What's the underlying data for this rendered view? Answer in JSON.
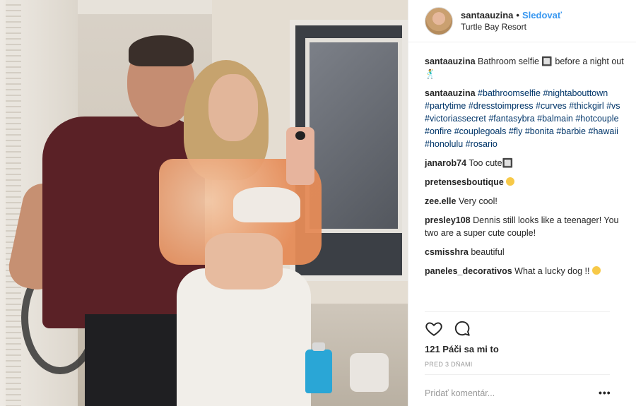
{
  "header": {
    "username": "santaauzina",
    "separator": "•",
    "follow_label": "Sledovať",
    "location": "Turtle Bay Resort"
  },
  "caption": {
    "username": "santaauzina",
    "text": "Bathroom selfie 🔲 before a night out 🕺"
  },
  "hashtags_comment": {
    "username": "santaauzina",
    "tags": [
      "#bathroomselfie",
      "#nightabouttown",
      "#partytime",
      "#dresstoimpress",
      "#curves",
      "#thickgirl",
      "#vs",
      "#victoriassecret",
      "#fantasybra",
      "#balmain",
      "#hotcouple",
      "#onfire",
      "#couplegoals",
      "#fly",
      "#bonita",
      "#barbie",
      "#hawaii",
      "#honolulu",
      "#rosario"
    ]
  },
  "comments": [
    {
      "username": "janarob74",
      "text": "Too cute🔲"
    },
    {
      "username": "pretensesboutique",
      "text": ""
    },
    {
      "username": "zee.elle",
      "text": "Very cool!"
    },
    {
      "username": "presley108",
      "text": "Dennis still looks like a teenager! You two are a super cute couple!"
    },
    {
      "username": "csmisshra",
      "text": "beautiful"
    },
    {
      "username": "paneles_decorativos",
      "text": "What a lucky dog !!"
    }
  ],
  "actions": {
    "like_icon": "heart-icon",
    "comment_icon": "comment-icon"
  },
  "likes": "121 Páči sa mi to",
  "timestamp": "PRED 3 DŇAMI",
  "add_comment_placeholder": "Pridať komentár...",
  "more_label": "•••",
  "colors": {
    "link": "#3897f0",
    "hashtag": "#003569",
    "muted": "#999999",
    "text": "#262626"
  }
}
